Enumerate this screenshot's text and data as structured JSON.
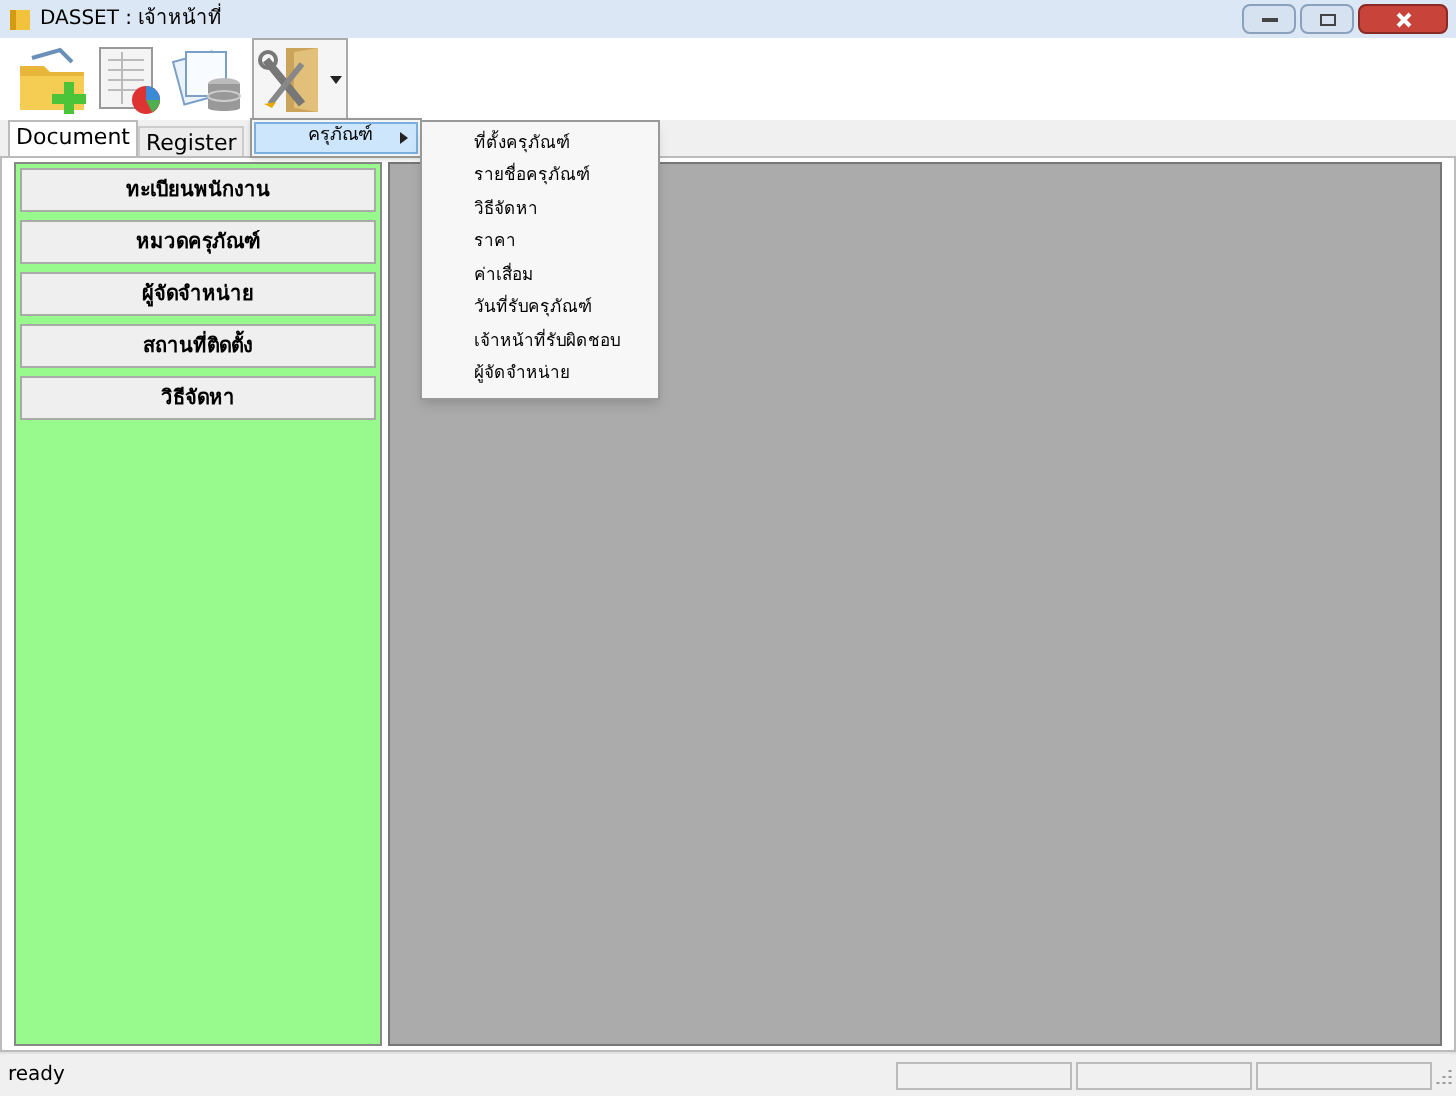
{
  "window": {
    "title": "DASSET : เจ้าหน้าที่"
  },
  "tabs": [
    {
      "label": "Document",
      "selected": true
    },
    {
      "label": "Register",
      "selected": false
    }
  ],
  "side_buttons": [
    "ทะเบียนพนักงาน",
    "หมวดครุภัณฑ์",
    "ผู้จัดจำหน่าย",
    "สถานที่ติดตั้ง",
    "วิธีจัดหา"
  ],
  "menu": {
    "items": [
      {
        "label": "ครุภัณฑ์",
        "selected": true
      }
    ]
  },
  "submenu": {
    "items": [
      "ที่ตั้งครุภัณฑ์",
      "รายชื่อครุภัณฑ์",
      "วิธีจัดหา",
      "ราคา",
      "ค่าเสื่อม",
      "วันที่รับครุภัณฑ์",
      "เจ้าหน้าที่รับผิดชอบ",
      "ผู้จัดจำหน่าย"
    ]
  },
  "status_bar": {
    "text": "ready"
  }
}
